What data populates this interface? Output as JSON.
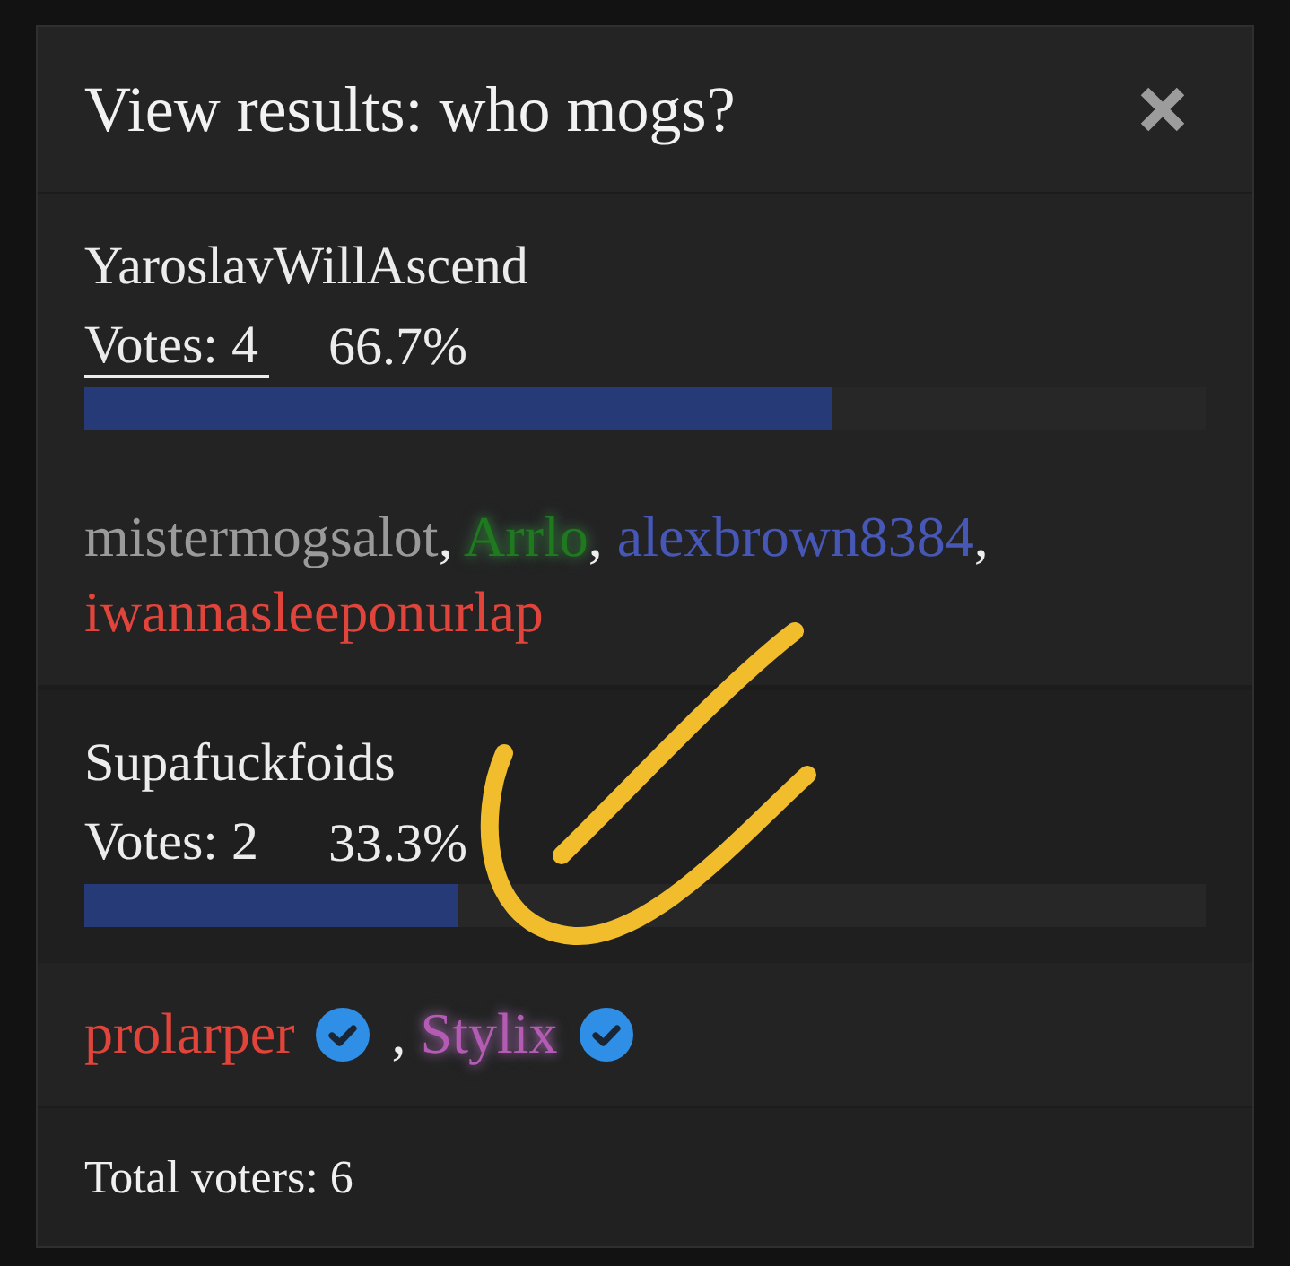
{
  "dialog": {
    "title": "View results: who mogs?"
  },
  "options": [
    {
      "name": "YaroslavWillAscend",
      "votes": "Votes: 4",
      "underlined": true,
      "percent": "66.7%",
      "level": 0.667,
      "voters": [
        {
          "name": "mistermogsalot",
          "color": "#9a9a9a",
          "glow": false,
          "verified": false
        },
        {
          "name": "Arrlo",
          "color": "#1f7a1f",
          "glow": true,
          "verified": false
        },
        {
          "name": "alexbrown8384",
          "color": "#4657b5",
          "glow": false,
          "verified": false
        },
        {
          "name": "iwannasleeponurlap",
          "color": "#e0443a",
          "glow": false,
          "verified": false
        }
      ]
    },
    {
      "name": "Supafuckfoids",
      "votes": "Votes: 2",
      "underlined": false,
      "percent": "33.3%",
      "level": 0.333,
      "voters": [
        {
          "name": "prolarper",
          "color": "#e0443a",
          "glow": false,
          "verified": true
        },
        {
          "name": "Stylix",
          "color": "#b45cb4",
          "glow": true,
          "verified": true
        }
      ]
    }
  ],
  "separator": ",",
  "footer": {
    "total": "Total voters: 6"
  }
}
